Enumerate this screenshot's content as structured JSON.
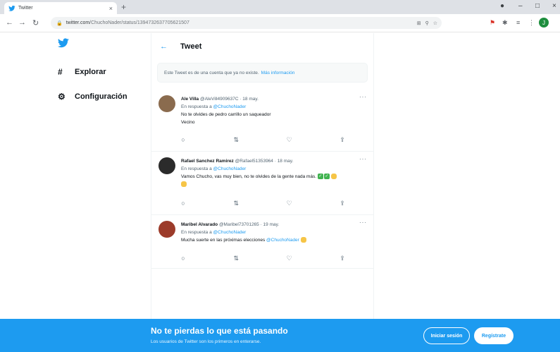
{
  "browser": {
    "tab_title": "Twitter",
    "tab_close": "×",
    "new_tab": "+",
    "url_domain": "twitter.com",
    "url_path": "/ChuchoNader/status/1394732637705621507",
    "window_controls": [
      "–",
      "□",
      "×"
    ],
    "profile_initial": "J"
  },
  "sidebar": {
    "items": [
      {
        "label": "Explorar",
        "icon": "hash-icon"
      },
      {
        "label": "Configuración",
        "icon": "gear-icon"
      }
    ]
  },
  "header": {
    "title": "Tweet",
    "back_glyph": "←"
  },
  "notice": {
    "text": "Este Tweet es de una cuenta que ya no existe.",
    "link": "Más información"
  },
  "tweets": [
    {
      "name": "Ale Villa",
      "meta": "@AleVill4909637C · 18 may.",
      "reply_prefix": "En respuesta a",
      "reply_to": "@ChuchoNader",
      "line1": "No te olvides de pedro carrillo un saqueador",
      "line2": "Vecino",
      "avatar_color": "#8a6b4e"
    },
    {
      "name": "Rafael Sanchez Ramirez",
      "meta": "@Rafael51353964 · 18 may.",
      "reply_prefix": "En respuesta a",
      "reply_to": "@ChuchoNader",
      "line1": "Vamos Chucho, vas muy bien, no te olvides de la gente nada más.",
      "avatar_color": "#2b2b2b"
    },
    {
      "name": "Maribel Alvarado",
      "meta": "@Maribel73701265 · 19 may.",
      "reply_prefix": "En respuesta a",
      "reply_to": "@ChuchoNader",
      "line1": "Mucha suerte en las próximas elecciones",
      "mention": "@ChuchoNader",
      "avatar_color": "#9c3b2a"
    }
  ],
  "banner": {
    "title": "No te pierdas lo que está pasando",
    "subtitle": "Los usuarios de Twitter son los primeros en enterarse.",
    "login_label": "Iniciar sesión",
    "signup_label": "Regístrate"
  },
  "colors": {
    "brand": "#1d9bf0",
    "text": "#0f1419",
    "muted": "#536471"
  }
}
